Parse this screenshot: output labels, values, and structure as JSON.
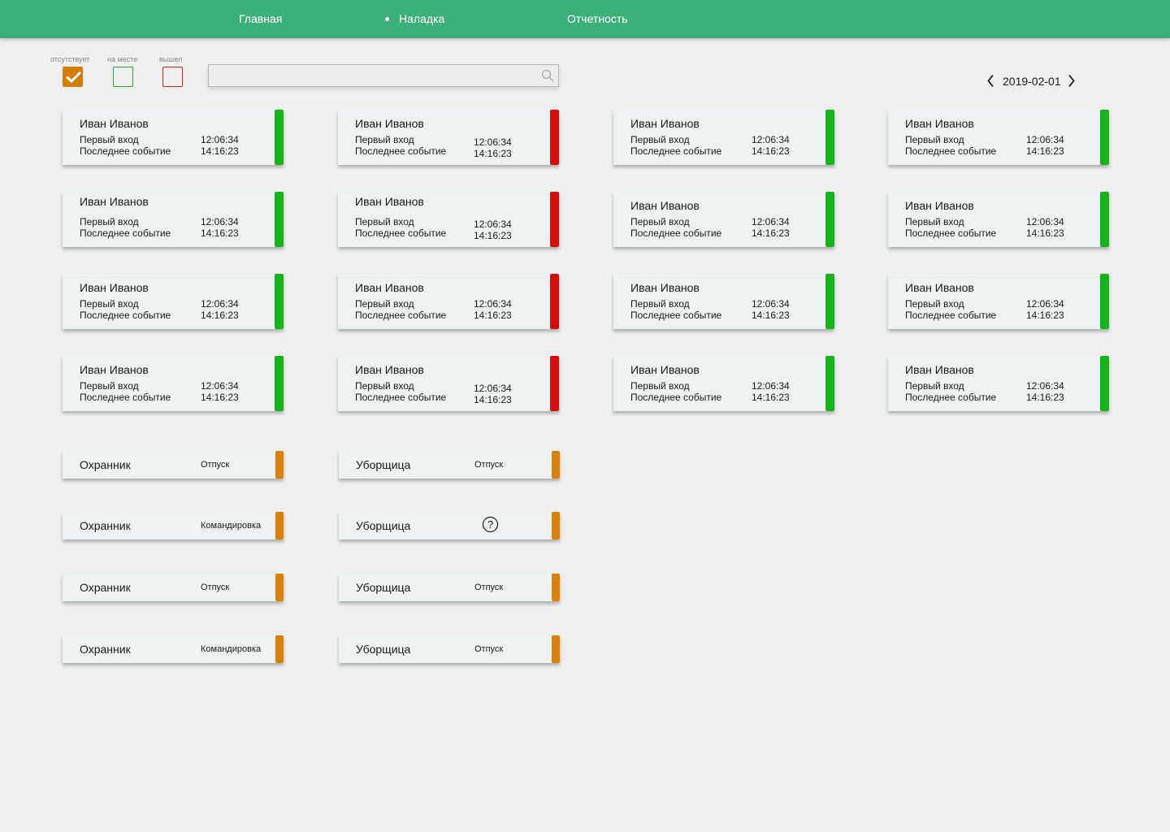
{
  "nav": {
    "items": [
      {
        "label": "Главная",
        "active": false
      },
      {
        "label": "Наладка",
        "active": true
      },
      {
        "label": "Отчетность",
        "active": false
      }
    ],
    "background": "#3daf7a"
  },
  "filters": [
    {
      "label": "отсутствует",
      "checked": true,
      "color": "#d17c0b"
    },
    {
      "label": "на месте",
      "checked": false,
      "color": "#2fa336"
    },
    {
      "label": "вышел",
      "checked": false,
      "color": "#d22222"
    }
  ],
  "search": {
    "value": "",
    "placeholder": "",
    "icon": "search-icon"
  },
  "date": {
    "value": "2019-02-01",
    "prev_icon": "chevron-left-icon",
    "next_icon": "chevron-right-icon"
  },
  "colors": {
    "present": "#17b31d",
    "left": "#d10e0e",
    "absent": "#d8810c"
  },
  "employees": [
    {
      "name": "Иван Иванов",
      "first_label": "Первый вход",
      "last_label": "Последнее событие",
      "first_time": "12:06:34",
      "last_time": "14:16:23",
      "status": "present"
    },
    {
      "name": "Иван Иванов",
      "first_label": "Первый вход",
      "last_label": "Последнее событие",
      "first_time": "12:06:34",
      "last_time": "14:16:23",
      "status": "left"
    },
    {
      "name": "Иван Иванов",
      "first_label": "Первый вход",
      "last_label": "Последнее событие",
      "first_time": "12:06:34",
      "last_time": "14:16:23",
      "status": "present"
    },
    {
      "name": "Иван Иванов",
      "first_label": "Первый вход",
      "last_label": "Последнее событие",
      "first_time": "12:06:34",
      "last_time": "14:16:23",
      "status": "present"
    },
    {
      "name": "Иван Иванов",
      "first_label": "Первый вход",
      "last_label": "Последнее событие",
      "first_time": "12:06:34",
      "last_time": "14:16:23",
      "status": "present"
    },
    {
      "name": "Иван Иванов",
      "first_label": "Первый вход",
      "last_label": "Последнее событие",
      "first_time": "12:06:34",
      "last_time": "14:16:23",
      "status": "left"
    },
    {
      "name": "Иван Иванов",
      "first_label": "Первый вход",
      "last_label": "Последнее событие",
      "first_time": "12:06:34",
      "last_time": "14:16:23",
      "status": "present"
    },
    {
      "name": "Иван Иванов",
      "first_label": "Первый вход",
      "last_label": "Последнее событие",
      "first_time": "12:06:34",
      "last_time": "14:16:23",
      "status": "present"
    },
    {
      "name": "Иван Иванов",
      "first_label": "Первый вход",
      "last_label": "Последнее событие",
      "first_time": "12:06:34",
      "last_time": "14:16:23",
      "status": "present"
    },
    {
      "name": "Иван Иванов",
      "first_label": "Первый вход",
      "last_label": "Последнее событие",
      "first_time": "12:06:34",
      "last_time": "14:16:23",
      "status": "left"
    },
    {
      "name": "Иван Иванов",
      "first_label": "Первый вход",
      "last_label": "Последнее событие",
      "first_time": "12:06:34",
      "last_time": "14:16:23",
      "status": "present"
    },
    {
      "name": "Иван Иванов",
      "first_label": "Первый вход",
      "last_label": "Последнее событие",
      "first_time": "12:06:34",
      "last_time": "14:16:23",
      "status": "present"
    },
    {
      "name": "Иван Иванов",
      "first_label": "Первый вход",
      "last_label": "Последнее событие",
      "first_time": "12:06:34",
      "last_time": "14:16:23",
      "status": "present"
    },
    {
      "name": "Иван Иванов",
      "first_label": "Первый вход",
      "last_label": "Последнее событие",
      "first_time": "12:06:34",
      "last_time": "14:16:23",
      "status": "left"
    },
    {
      "name": "Иван Иванов",
      "first_label": "Первый вход",
      "last_label": "Последнее событие",
      "first_time": "12:06:34",
      "last_time": "14:16:23",
      "status": "present"
    },
    {
      "name": "Иван Иванов",
      "first_label": "Первый вход",
      "last_label": "Последнее событие",
      "first_time": "12:06:34",
      "last_time": "14:16:23",
      "status": "present"
    }
  ],
  "absences": [
    {
      "name": "Охранник",
      "status": "Отпуск"
    },
    {
      "name": "Уборщица",
      "status": "Отпуск"
    },
    {
      "name": "Охранник",
      "status": "Командировка"
    },
    {
      "name": "Уборщица",
      "status": "",
      "icon": "help-icon"
    },
    {
      "name": "Охранник",
      "status": "Отпуск"
    },
    {
      "name": "Уборщица",
      "status": "Отпуск"
    },
    {
      "name": "Охранник",
      "status": "Командировка"
    },
    {
      "name": "Уборщица",
      "status": "Отпуск"
    }
  ]
}
